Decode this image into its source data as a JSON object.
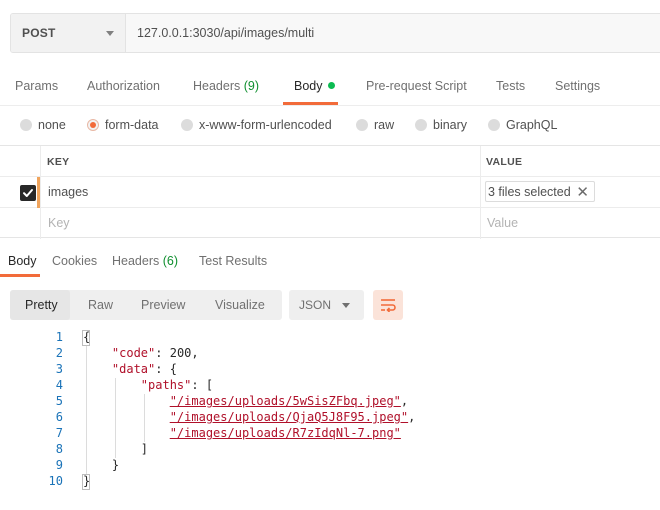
{
  "request": {
    "method": "POST",
    "url": "127.0.0.1:3030/api/images/multi"
  },
  "request_tabs": {
    "params": "Params",
    "authorization": "Authorization",
    "headers": "Headers",
    "headers_count": "(9)",
    "body": "Body",
    "prerequest": "Pre-request Script",
    "tests": "Tests",
    "settings": "Settings"
  },
  "body_types": {
    "none": "none",
    "form_data": "form-data",
    "urlencoded": "x-www-form-urlencoded",
    "raw": "raw",
    "binary": "binary",
    "graphql": "GraphQL",
    "selected": "form-data"
  },
  "form_table": {
    "key_header": "KEY",
    "value_header": "VALUE",
    "row_key": "images",
    "row_value": "3 files selected",
    "key_placeholder": "Key",
    "value_placeholder": "Value"
  },
  "response_tabs": {
    "body": "Body",
    "cookies": "Cookies",
    "headers": "Headers",
    "headers_count": "(6)",
    "test_results": "Test Results"
  },
  "response_toolbar": {
    "pretty": "Pretty",
    "raw": "Raw",
    "preview": "Preview",
    "visualize": "Visualize",
    "language": "JSON"
  },
  "response_code": {
    "line_numbers": [
      "1",
      "2",
      "3",
      "4",
      "5",
      "6",
      "7",
      "8",
      "9",
      "10"
    ],
    "open_brace": "{",
    "code_key": "\"code\"",
    "code_value": "200",
    "data_key": "\"data\"",
    "paths_key": "\"paths\"",
    "path_1": "\"/images/uploads/5wSisZFbq.jpeg\"",
    "path_2": "\"/images/uploads/QjaQ5J8F95.jpeg\"",
    "path_3": "\"/images/uploads/R7zIdqNl-7.png\"",
    "close_bracket": "]",
    "close_data": "}",
    "close_brace": "}"
  },
  "colors": {
    "accent": "#f26b3a",
    "success": "#0cbb52",
    "json_string": "#b0102a",
    "line_number": "#1a73b8"
  },
  "icons": [
    "caret-down-icon",
    "status-dot-icon",
    "checkbox-checked-icon",
    "close-icon",
    "wrap-lines-icon"
  ]
}
